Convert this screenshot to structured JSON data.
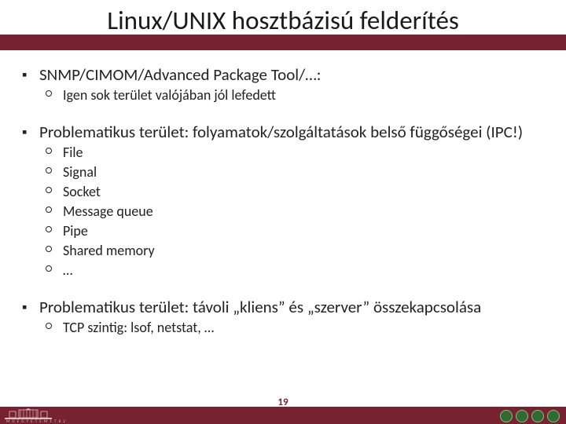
{
  "title": "Linux/UNIX hosztbázisú felderítés",
  "b1": {
    "text": "SNMP/CIMOM/Advanced Package Tool/…:",
    "sub": [
      "Igen sok terület valójában jól lefedett"
    ]
  },
  "b2": {
    "text": "Problematikus terület: folyamatok/szolgáltatások belső függőségei (IPC!)",
    "sub": [
      "File",
      "Signal",
      "Socket",
      "Message queue",
      "Pipe",
      "Shared memory",
      "…"
    ]
  },
  "b3": {
    "text": "Problematikus terület: távoli „kliens” és „szerver” összekapcsolása",
    "sub": [
      "TCP szintig: lsof, netstat, …"
    ]
  },
  "page_number": "19",
  "footer_small": "M Ű E G Y E T E M  1 7 8 2",
  "bullet_square": "▪"
}
